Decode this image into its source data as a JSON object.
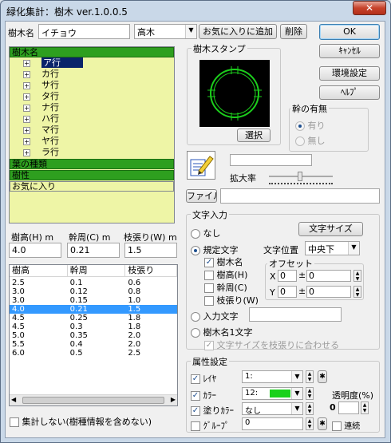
{
  "window": {
    "title": "緑化集計：樹木 ver.1.0.0.5",
    "close": "✕"
  },
  "top": {
    "name_label": "樹木名",
    "name_value": "イチョウ",
    "type_value": "高木",
    "fav_add": "お気に入りに追加",
    "delete": "削除"
  },
  "buttons": {
    "ok": "OK",
    "cancel": "ｷｬﾝｾﾙ",
    "settings": "環境設定",
    "help": "ﾍﾙﾌﾟ",
    "select": "選択",
    "file": "ファイル",
    "moji_size": "文字サイズ"
  },
  "tree": {
    "header": "樹木名",
    "items": [
      "ア行",
      "カ行",
      "サ行",
      "タ行",
      "ナ行",
      "ハ行",
      "マ行",
      "ヤ行",
      "ラ行"
    ],
    "bars": [
      "葉の種類",
      "樹性",
      "お気に入り"
    ]
  },
  "stamp": {
    "label": "樹木スタンプ"
  },
  "trunk": {
    "label": "幹の有無",
    "yes": "有り",
    "no": "無し"
  },
  "zoom": {
    "label": "拡大率"
  },
  "dims": {
    "h_label": "樹高(H) m",
    "c_label": "幹周(C) m",
    "w_label": "枝張り(W) m",
    "h": "4.0",
    "c": "0.21",
    "w": "1.5"
  },
  "list": {
    "headers": [
      "樹高",
      "幹周",
      "枝張り"
    ],
    "rows": [
      [
        "2.5",
        "0.1",
        "0.6"
      ],
      [
        "3.0",
        "0.12",
        "0.8"
      ],
      [
        "3.0",
        "0.15",
        "1.0"
      ],
      [
        "4.0",
        "0.21",
        "1.5"
      ],
      [
        "4.5",
        "0.25",
        "1.8"
      ],
      [
        "4.5",
        "0.3",
        "1.8"
      ],
      [
        "5.0",
        "0.35",
        "2.0"
      ],
      [
        "5.5",
        "0.4",
        "2.0"
      ],
      [
        "6.0",
        "0.5",
        "2.5"
      ]
    ],
    "selected": 3
  },
  "no_sum": "集計しない(樹種情報を含めない)",
  "moji": {
    "group": "文字入力",
    "none": "なし",
    "std": "規定文字",
    "pos_label": "文字位置",
    "pos_value": "中央下",
    "chk_name": "樹木名",
    "chk_h": "樹高(H)",
    "chk_c": "幹周(C)",
    "chk_w": "枝張り(W)",
    "offset": "オフセット",
    "x_label": "X",
    "y_label": "Y",
    "x_val": "0",
    "y_val": "0",
    "x_num": "0",
    "y_num": "0",
    "input": "入力文字",
    "one": "樹木名1文字",
    "fit": "文字サイズを枝張りに合わせる"
  },
  "attr": {
    "group": "属性設定",
    "layer": "ﾚｲﾔ",
    "layer_val": "1:",
    "color": "ｶﾗｰ",
    "color_val": "12:",
    "fill": "塗りｶﾗｰ",
    "fill_val": "なし",
    "group_lbl": "ｸﾞﾙｰﾌﾟ",
    "group_val": "0",
    "trans": "透明度(%)",
    "trans_val": "0",
    "renzoku": "連続",
    "star": "✱",
    "color_swatch": "#19d11b"
  },
  "icons": [
    "close-icon",
    "plus-icon",
    "pencil-paper-icon",
    "spin-up-icon",
    "spin-down-icon",
    "dropdown-arrow-icon"
  ]
}
